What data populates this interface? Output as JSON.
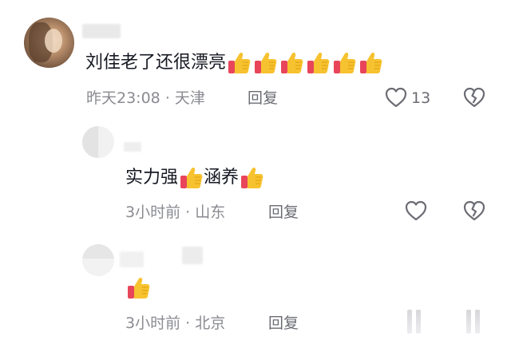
{
  "comments": [
    {
      "text": "刘佳老了还很漂亮",
      "emoji_count": 6,
      "emoji_icon": "thumbs-up-icon",
      "time": "昨天23:08",
      "separator": "·",
      "location": "天津",
      "reply_label": "回复",
      "like_count": "13"
    },
    {
      "text_part1": "实力强",
      "text_part2": "涵养",
      "emoji_icon": "thumbs-up-icon",
      "time": "3小时前",
      "separator": "·",
      "location": "山东",
      "reply_label": "回复"
    },
    {
      "emoji_icon": "thumbs-up-icon",
      "time": "3小时前",
      "separator": "·",
      "location": "北京",
      "reply_label": "回复"
    }
  ],
  "colors": {
    "text": "#161823",
    "meta": "#8a8b91",
    "icon": "#6b6c73",
    "thumb_main": "#f7c22f",
    "thumb_cuff": "#e8455a"
  }
}
